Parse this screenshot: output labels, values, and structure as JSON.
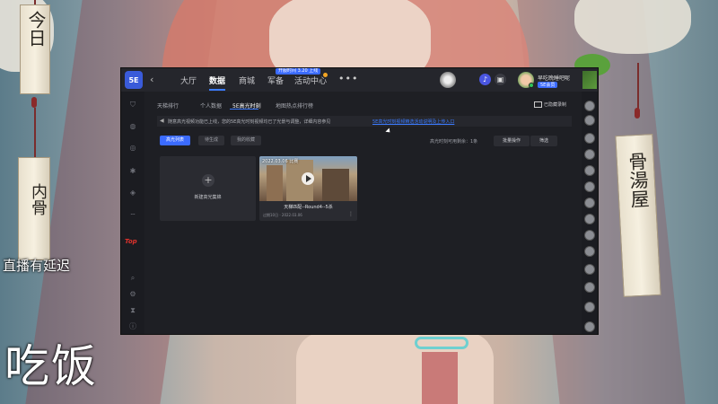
{
  "overlay": {
    "left_tablet_top": "今日",
    "left_tablet_bottom": "内骨",
    "right_tablet": "骨湯屋",
    "stream_delay": "直播有延迟",
    "eating": "吃饭"
  },
  "app": {
    "logo": "5E",
    "nav": [
      "大厅",
      "数据",
      "商城",
      "军备",
      "活动中心"
    ],
    "active_nav": "数据",
    "event_badge": "开服时间 3.20 上线",
    "user": {
      "name": "早吃晚睡吧呢",
      "tag": "5E会员"
    },
    "subtabs": [
      "天梯排行",
      "个人数据",
      "5E高光时刻",
      "地图热点排行榜"
    ],
    "active_subtab": "5E高光时刻",
    "record_button": "已隐藏录制",
    "notice": {
      "text": "随意高光视频功能已上线，您的5E高光时刻视频均已了光景与调整，详细内容参见",
      "link": "5E高光时刻视频精选活动说明及上传入口"
    },
    "filters": [
      "高光列表",
      "待生成",
      "我的收藏"
    ],
    "active_filter": "高光列表",
    "counter": "高光时刻可用剩余：1条",
    "actions": {
      "batch": "批量操作",
      "filter": "筛选"
    },
    "new_card": {
      "label": "新建高光集锦"
    },
    "video_card": {
      "date": "2022.03.06 比赛",
      "title": "天梯匹配--Round4--5杀",
      "meta": "过期10日 · 2022.03.06"
    }
  },
  "colors": {
    "accent": "#3b6bff",
    "app_bg": "#1e1f24",
    "red_logo": "#e0322c"
  }
}
